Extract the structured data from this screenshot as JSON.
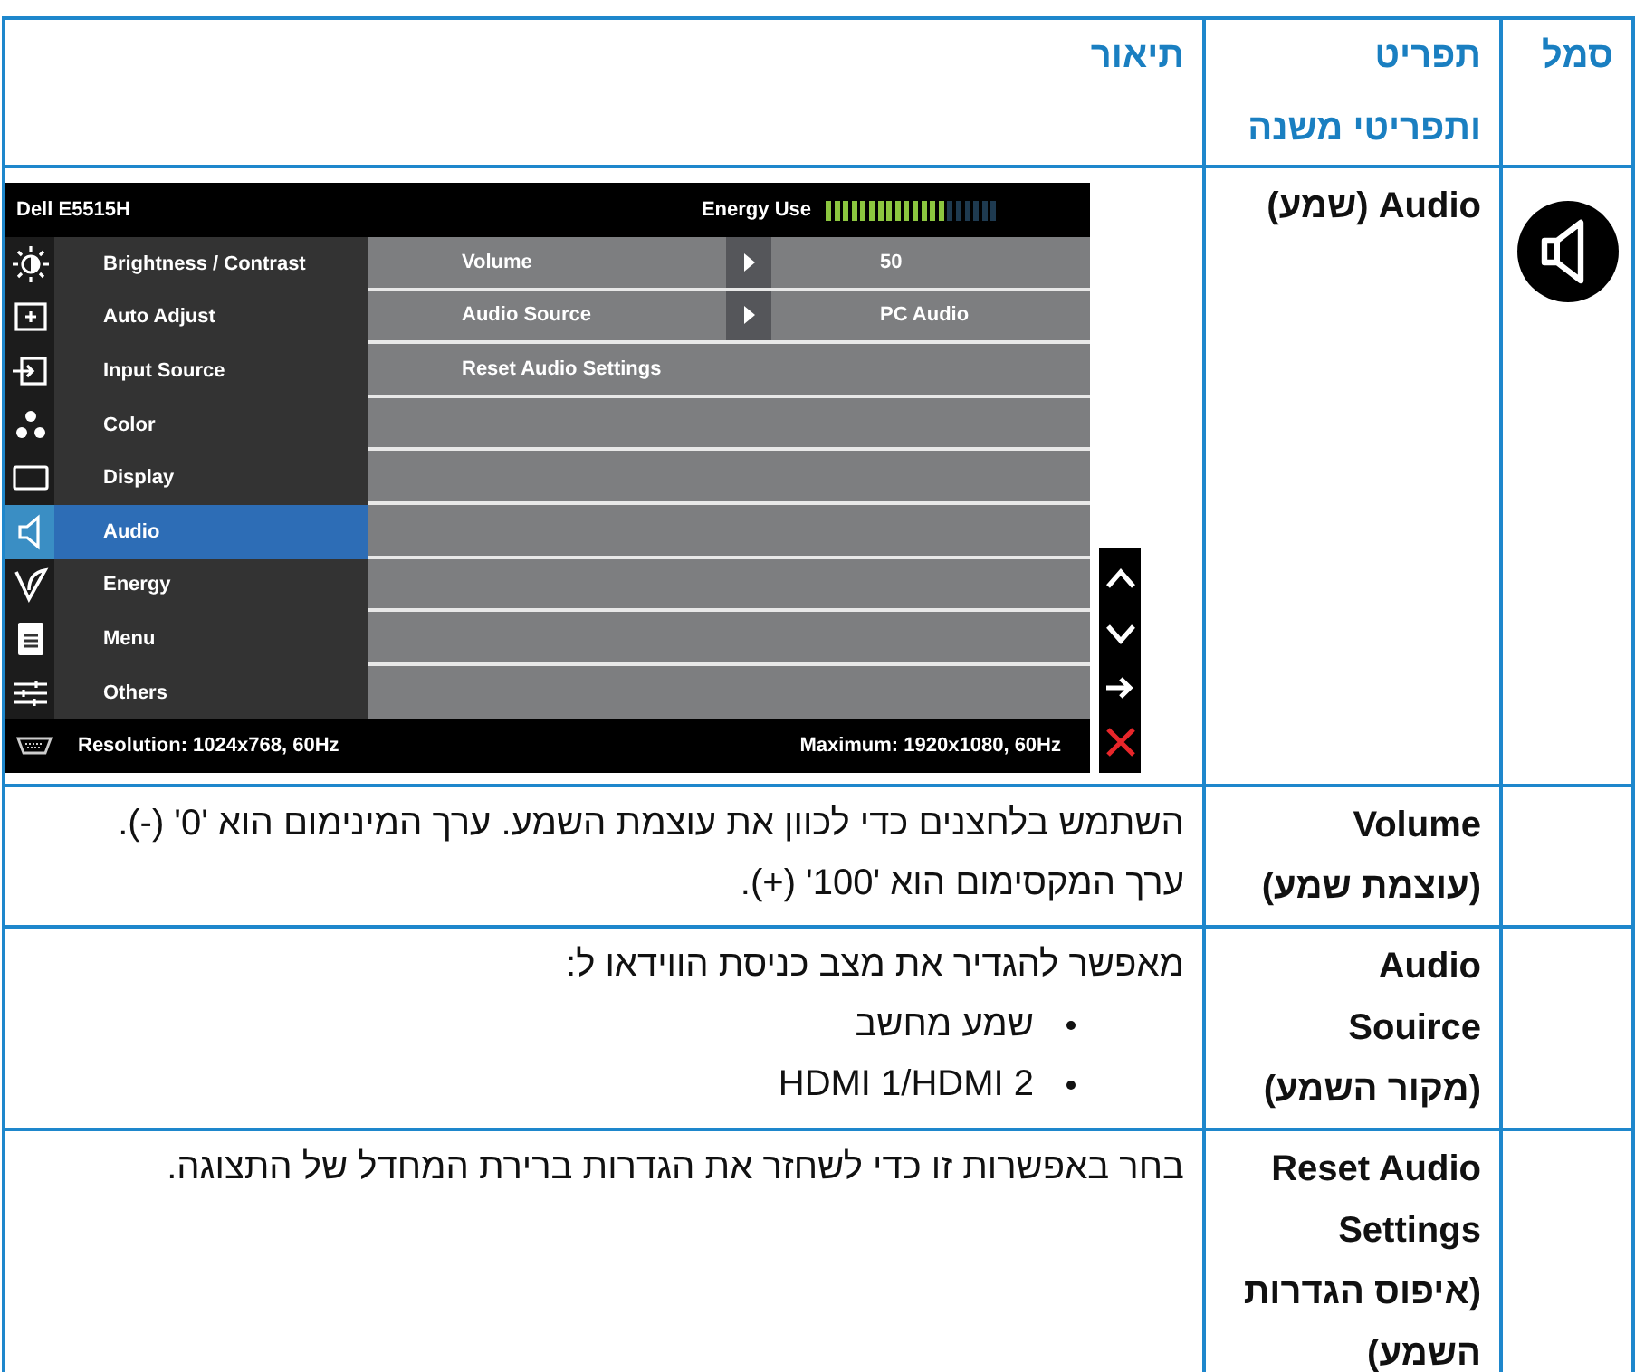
{
  "table": {
    "columns": [
      "סמל",
      "תפריט\nותפריטי משנה",
      "תיאור"
    ],
    "rows": [
      {
        "kind": "osd",
        "menu": "Audio (שמע)",
        "osd": {
          "title": "Dell E5515H",
          "energy_label": "Energy Use",
          "energy": {
            "level": 0.7
          },
          "menu": [
            {
              "kind": "brightness",
              "label": "Brightness / Contrast",
              "selected": false
            },
            {
              "kind": "auto-adjust",
              "label": "Auto Adjust",
              "selected": false
            },
            {
              "kind": "input",
              "label": "Input Source",
              "selected": false
            },
            {
              "kind": "color",
              "label": "Color",
              "selected": false
            },
            {
              "kind": "display",
              "label": "Display",
              "selected": false
            },
            {
              "kind": "audio",
              "label": "Audio",
              "selected": true
            },
            {
              "kind": "energy",
              "label": "Energy",
              "selected": false
            },
            {
              "kind": "menu",
              "label": "Menu",
              "selected": false
            },
            {
              "kind": "others",
              "label": "Others",
              "selected": false
            }
          ],
          "submenu": [
            {
              "kind": "value",
              "label": "Volume",
              "value": "50"
            },
            {
              "kind": "value",
              "label": "Audio Source",
              "value": "PC Audio"
            },
            {
              "kind": "action",
              "label": "Reset Audio Settings"
            }
          ],
          "resolution": "Resolution: 1024x768, 60Hz",
          "maximum": "Maximum: 1920x1080, 60Hz",
          "nav_buttons": [
            {
              "kind": "up"
            },
            {
              "kind": "down"
            },
            {
              "kind": "right"
            },
            {
              "kind": "close"
            }
          ]
        }
      },
      {
        "kind": "text",
        "menu": "Volume\n(עוצמת שמע)",
        "description": "השתמש בלחצנים כדי לכוון את עוצמת השמע. ערך המינימום הוא '0' (-). ערך המקסימום הוא '100' (+)."
      },
      {
        "kind": "text",
        "menu": "Audio\nSouirce\n(מקור השמע)",
        "description": "מאפשר להגדיר את מצב כניסת הווידאו ל:",
        "bullets": [
          "שמע מחשב",
          "HDMI 1/HDMI 2"
        ]
      },
      {
        "kind": "text",
        "menu": "Reset Audio\nSettings\n(איפוס הגדרות\nהשמע)",
        "description": "בחר באפשרות זו כדי לשחזר את הגדרות ברירת המחדל של התצוגה."
      }
    ]
  }
}
